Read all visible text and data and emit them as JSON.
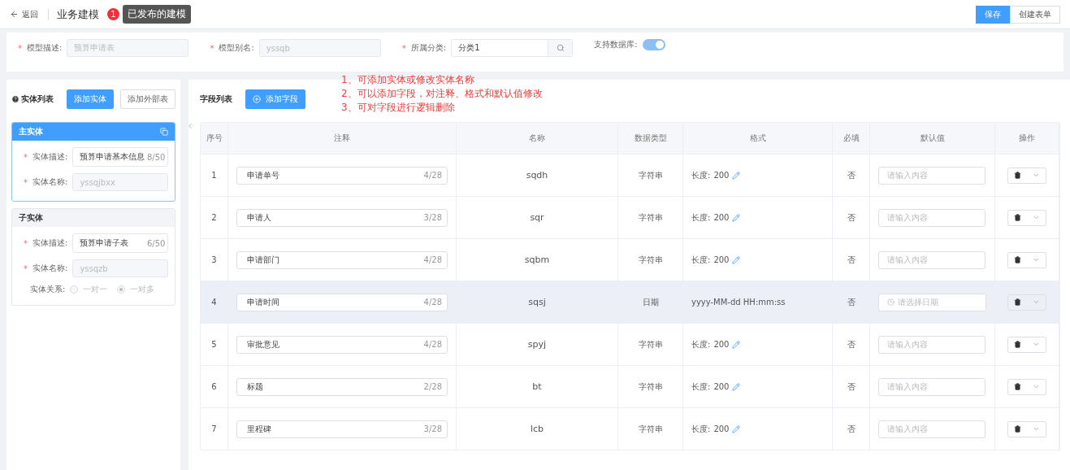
{
  "header": {
    "back": "返回",
    "title": "业务建模",
    "badge": "1",
    "tooltip": "已发布的建模",
    "buttons": [
      {
        "label": "保存",
        "primary": true
      },
      {
        "label": "创建表单",
        "primary": false
      }
    ]
  },
  "model_form": {
    "fields": [
      {
        "label": "模型描述:",
        "mark": "*",
        "kind": "text",
        "value": "预算申请表"
      },
      {
        "label": "模型别名:",
        "mark": "*",
        "kind": "text",
        "value": "yssqb"
      },
      {
        "label": "所属分类:",
        "mark": "*",
        "kind": "search",
        "value": "分类1"
      }
    ],
    "toggle": {
      "label": "支持数据库:",
      "on": true
    }
  },
  "annotations": [
    "1、可添加实体或修改实体名称",
    "2、可以添加字段，对注释、格式和默认值修改",
    "3、可对字段进行逻辑删除"
  ],
  "entity_panel": {
    "title": "实体列表",
    "buttons": [
      {
        "label": "添加实体",
        "primary": true
      },
      {
        "label": "添加外部表",
        "primary": false
      }
    ],
    "entities": [
      {
        "title": "主实体",
        "active": true,
        "mark": "*",
        "desc_label": "实体描述:",
        "desc": "预算申请基本信息",
        "desc_count": "8/50",
        "name_label": "实体名称:",
        "name": "yssqjbxx"
      },
      {
        "title": "子实体",
        "active": false,
        "mark": "*",
        "desc_label": "实体描述:",
        "desc": "预算申请子表",
        "desc_count": "6/50",
        "name_label": "实体名称:",
        "name": "yssqzb",
        "relation": {
          "label": "实体关系:",
          "options": [
            {
              "label": "一对一",
              "selected": false
            },
            {
              "label": "一对多",
              "selected": true
            }
          ]
        }
      }
    ]
  },
  "field_panel": {
    "title": "字段列表",
    "add_button": "添加字段",
    "columns": [
      "序号",
      "注释",
      "名称",
      "数据类型",
      "格式",
      "必填",
      "默认值",
      "操作"
    ],
    "rows": [
      {
        "no": "1",
        "comment": "申请单号",
        "count": "4/28",
        "name": "sqdh",
        "type": "字符串",
        "kind": "string",
        "format": "长度:",
        "length": "200",
        "required": "否",
        "placeholder": "请输入内容",
        "hovered": false
      },
      {
        "no": "2",
        "comment": "申请人",
        "count": "3/28",
        "name": "sqr",
        "type": "字符串",
        "kind": "string",
        "format": "长度:",
        "length": "200",
        "required": "否",
        "placeholder": "请输入内容",
        "hovered": false
      },
      {
        "no": "3",
        "comment": "申请部门",
        "count": "4/28",
        "name": "sqbm",
        "type": "字符串",
        "kind": "string",
        "format": "长度:",
        "length": "200",
        "required": "否",
        "placeholder": "请输入内容",
        "hovered": false
      },
      {
        "no": "4",
        "comment": "申请时间",
        "count": "4/28",
        "name": "sqsj",
        "type": "日期",
        "kind": "date",
        "format": "yyyy-MM-dd HH:mm:ss",
        "required": "否",
        "placeholder": "请选择日期",
        "hovered": true
      },
      {
        "no": "5",
        "comment": "审批意见",
        "count": "4/28",
        "name": "spyj",
        "type": "字符串",
        "kind": "string",
        "format": "长度:",
        "length": "200",
        "required": "否",
        "placeholder": "请输入内容",
        "hovered": false
      },
      {
        "no": "6",
        "comment": "标题",
        "count": "2/28",
        "name": "bt",
        "type": "字符串",
        "kind": "string",
        "format": "长度:",
        "length": "200",
        "required": "否",
        "placeholder": "请输入内容",
        "hovered": false
      },
      {
        "no": "7",
        "comment": "里程碑",
        "count": "3/28",
        "name": "lcb",
        "type": "字符串",
        "kind": "string",
        "format": "长度:",
        "length": "200",
        "required": "否",
        "placeholder": "请输入内容",
        "hovered": false
      }
    ]
  }
}
